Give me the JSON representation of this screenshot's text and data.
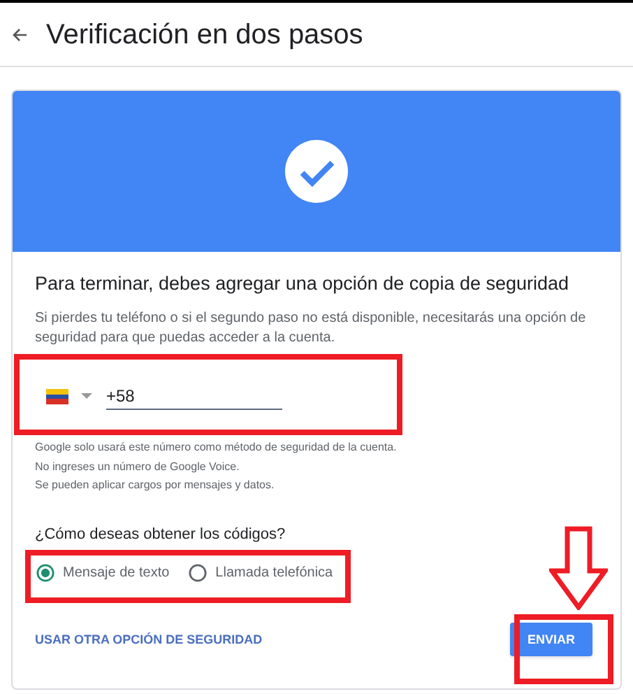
{
  "header": {
    "title": "Verificación en dos pasos"
  },
  "card": {
    "heading": "Para terminar, debes agregar una opción de copia de seguridad",
    "description": "Si pierdes tu teléfono o si el segundo paso no está disponible, necesitarás una opción de seguridad para que puedas acceder a la cuenta.",
    "phone": {
      "value": "+58"
    },
    "notes": [
      "Google solo usará este número como método de seguridad de la cuenta.",
      "No ingreses un número de Google Voice.",
      "Se pueden aplicar cargos por mensajes y datos."
    ],
    "question": "¿Cómo deseas obtener los códigos?",
    "options": [
      {
        "label": "Mensaje de texto",
        "selected": true
      },
      {
        "label": "Llamada telefónica",
        "selected": false
      }
    ],
    "link": "USAR OTRA OPCIÓN DE SEGURIDAD",
    "button": "ENVIAR"
  }
}
